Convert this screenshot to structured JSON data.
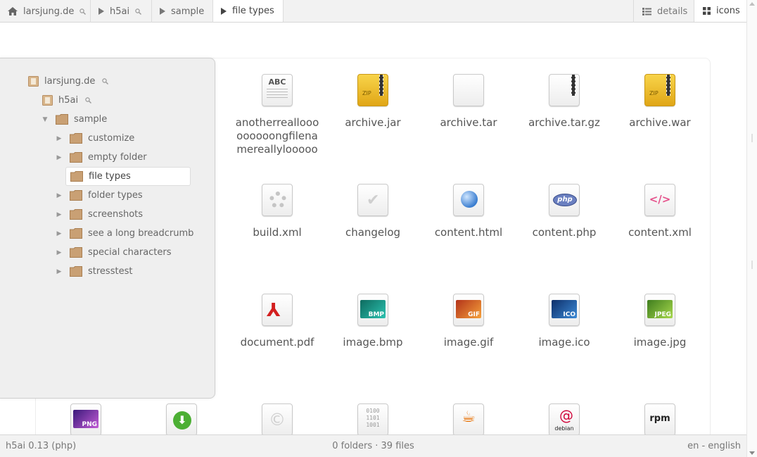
{
  "breadcrumb": {
    "home": "larsjung.de",
    "h5ai": "h5ai",
    "sample": "sample",
    "current": "file types"
  },
  "views": {
    "details": "details",
    "icons": "icons"
  },
  "tree": {
    "root": "larsjung.de",
    "h5ai": "h5ai",
    "sample": "sample",
    "children": [
      "customize",
      "empty folder",
      "file types",
      "folder types",
      "screenshots",
      "see a long breadcrumb",
      "special characters",
      "stresstest"
    ]
  },
  "files": [
    "anotherreallooooooooongfilenamereallyloooooooooooong",
    "archive.jar",
    "archive.tar",
    "archive.tar.gz",
    "archive.war",
    "build.xml",
    "changelog",
    "content.html",
    "content.php",
    "content.xml",
    "document.pdf",
    "image.bmp",
    "image.gif",
    "image.ico",
    "image.jpg"
  ],
  "thumb_labels": {
    "abc": "ABC",
    "zip": "ZIP",
    "php": "php",
    "bmp": "BMP",
    "gif": "GIF",
    "ico": "ICO",
    "jpeg": "JPEG",
    "png": "PNG",
    "binary": "0100\n1101\n1001",
    "debian": "debian",
    "rpm": "rpm"
  },
  "status": {
    "version": "h5ai 0.13 (php)",
    "summary": "0 folders · 39 files",
    "language": "en - english"
  },
  "colors": {
    "bar_bg": "#f2f2f2",
    "tree_bg": "#efefef",
    "folder": "#c9a074"
  }
}
